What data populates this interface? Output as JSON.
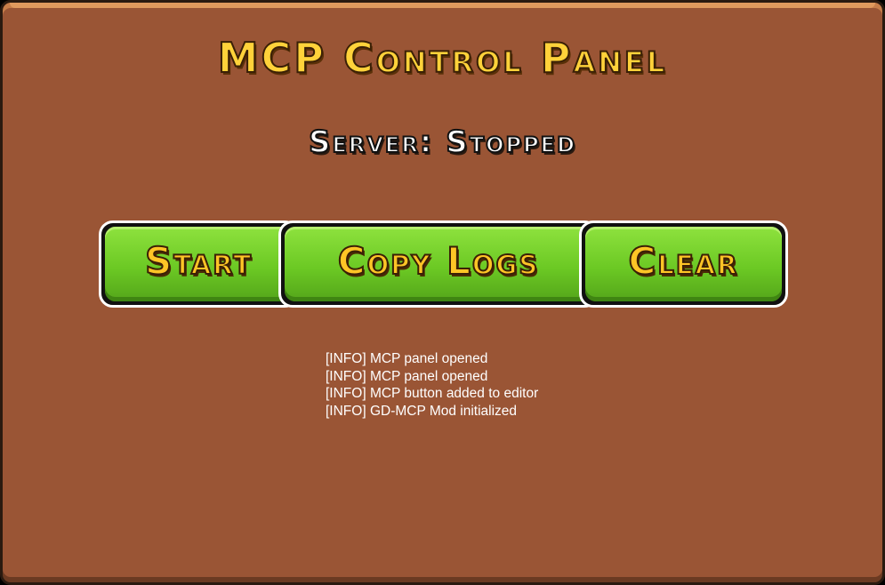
{
  "title": "MCP Control Panel",
  "status": "Server: Stopped",
  "buttons": {
    "start": "Start",
    "copy_logs": "Copy Logs",
    "clear": "Clear"
  },
  "logs": [
    "[INFO] MCP panel opened",
    "[INFO] MCP panel opened",
    "[INFO] MCP button added to editor",
    "[INFO] GD-MCP Mod initialized"
  ],
  "colors": {
    "panel": "#9a5535",
    "button_green": "#6cc924",
    "title_yellow": "#ffd23a"
  }
}
